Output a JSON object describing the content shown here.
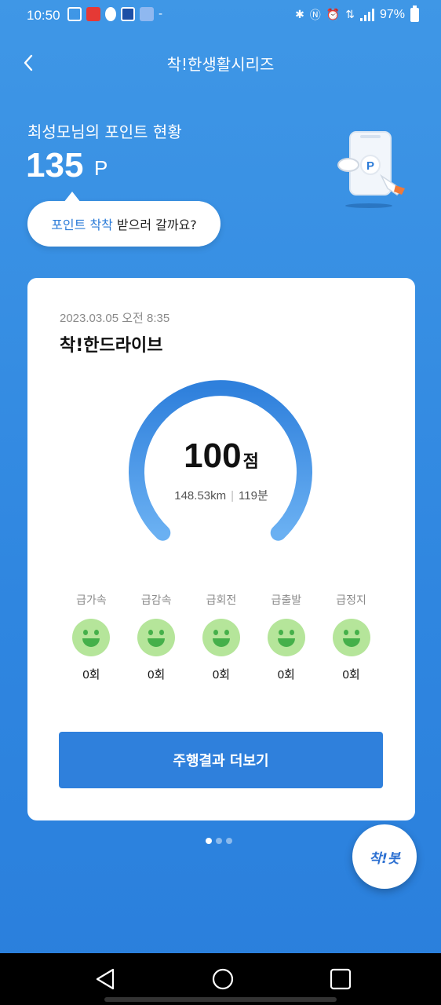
{
  "status_bar": {
    "time": "10:50",
    "battery": "97%",
    "dash": "-"
  },
  "header": {
    "title": "착!한생활시리즈"
  },
  "points": {
    "label": "최성모님의 포인트 현황",
    "value": "135",
    "unit": "P",
    "illustration_letter": "P"
  },
  "bubble": {
    "highlight": "포인트 착착",
    "text": "받으러 갈까요?"
  },
  "card": {
    "date": "2023.03.05 오전 8:35",
    "title": "착!한드라이브",
    "score": "100",
    "score_unit": "점",
    "distance": "148.53km",
    "duration": "119분",
    "events": [
      {
        "label": "급가속",
        "count": "0회"
      },
      {
        "label": "급감속",
        "count": "0회"
      },
      {
        "label": "급회전",
        "count": "0회"
      },
      {
        "label": "급출발",
        "count": "0회"
      },
      {
        "label": "급정지",
        "count": "0회"
      }
    ],
    "more_button": "주행결과 더보기"
  },
  "pager": {
    "total": 3,
    "active": 1
  },
  "bot_button": "착!봇",
  "colors": {
    "background": "#3a90e4",
    "accent": "#2f80dc",
    "face": "#b5e59a",
    "face_feature": "#45b04a"
  }
}
